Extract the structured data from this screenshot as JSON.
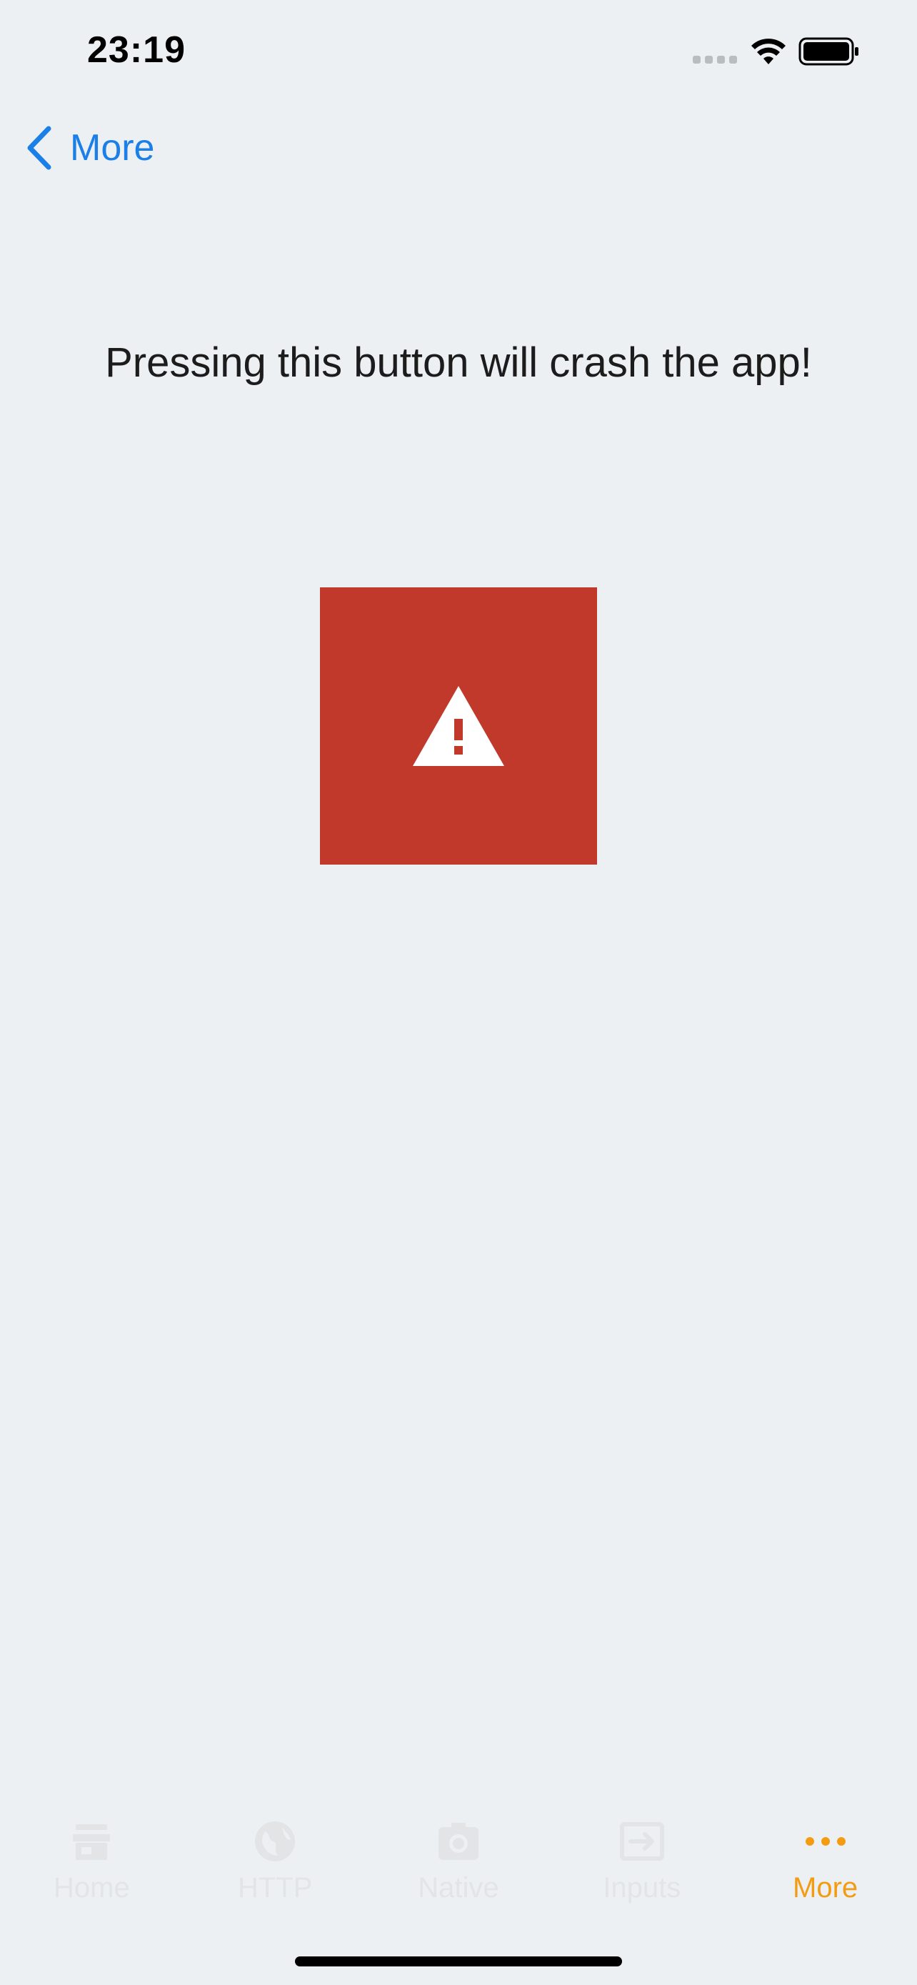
{
  "status_bar": {
    "time": "23:19"
  },
  "nav": {
    "back_label": "More"
  },
  "main": {
    "message": "Pressing this button will crash the app!"
  },
  "colors": {
    "accent": "#1a7fe6",
    "danger": "#c0392b",
    "tab_active": "#f39c12",
    "tab_inactive": "#e2e4e6"
  },
  "tabs": [
    {
      "label": "Home",
      "icon": "store-icon",
      "active": false
    },
    {
      "label": "HTTP",
      "icon": "globe-icon",
      "active": false
    },
    {
      "label": "Native",
      "icon": "camera-icon",
      "active": false
    },
    {
      "label": "Inputs",
      "icon": "input-icon",
      "active": false
    },
    {
      "label": "More",
      "icon": "more-icon",
      "active": true
    }
  ]
}
